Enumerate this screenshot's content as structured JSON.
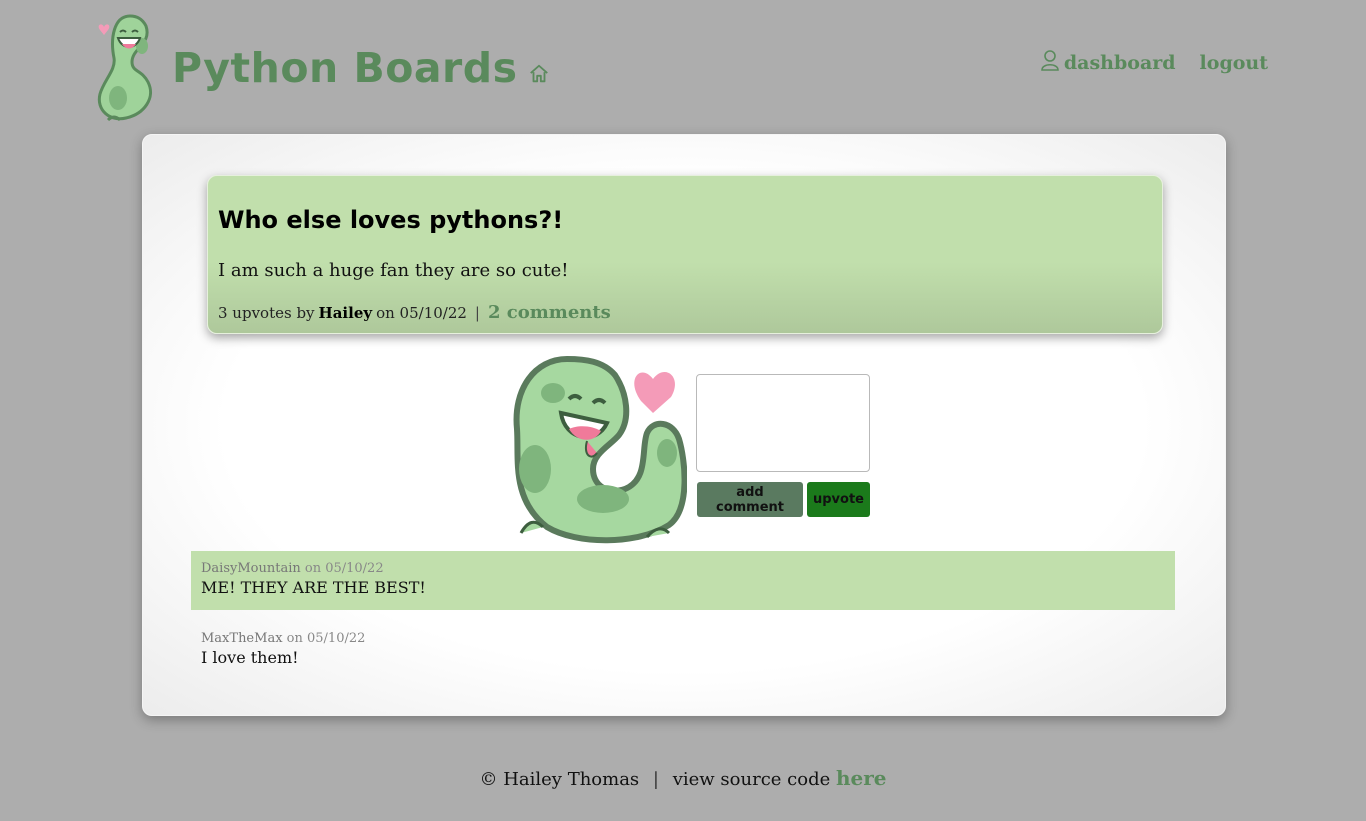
{
  "header": {
    "brand_title": "Python Boards",
    "nav": {
      "dashboard_label": "dashboard",
      "logout_label": "logout"
    },
    "icons": [
      "python-mascot-logo",
      "home-icon",
      "user-icon"
    ]
  },
  "post": {
    "title": "Who else loves pythons?!",
    "body": "I am such a huge fan they are so cute!",
    "upvotes_text": "3 upvotes by",
    "author": "Hailey",
    "date_text": "on 05/10/22",
    "separator": "|",
    "comments_link": "2 comments"
  },
  "comment_form": {
    "textarea_value": "",
    "add_comment_label": "add comment",
    "upvote_label": "upvote"
  },
  "comments": [
    {
      "author": "DaisyMountain",
      "date_text": "on 05/10/22",
      "text": "ME! THEY ARE THE BEST!"
    },
    {
      "author": "MaxTheMax",
      "date_text": "on 05/10/22",
      "text": "I love them!"
    }
  ],
  "footer": {
    "copyright": "© Hailey Thomas",
    "separator": "|",
    "source_text": "view source code",
    "source_link": "here"
  },
  "colors": {
    "brand_green": "#5a8a5c",
    "post_bg": "#c1dfac",
    "page_bg": "#adadad",
    "upvote_btn": "#1b7a1b",
    "comment_btn": "#5a7a60"
  }
}
